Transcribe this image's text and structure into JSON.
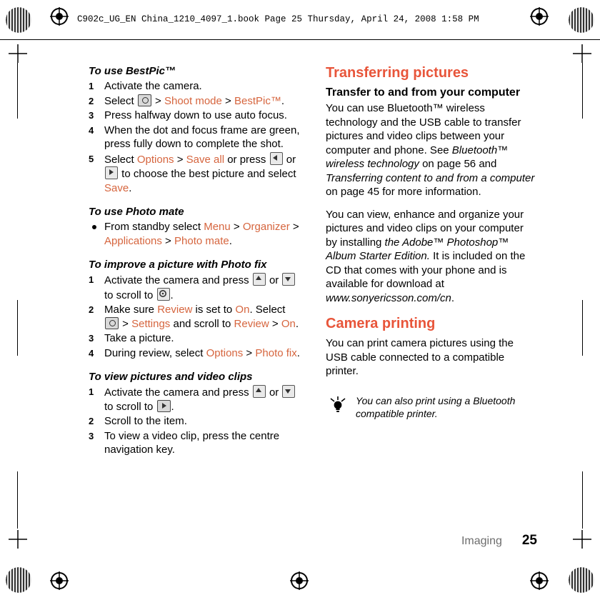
{
  "header": {
    "filename_line": "C902c_UG_EN China_1210_4097_1.book  Page 25  Thursday, April 24, 2008  1:58 PM"
  },
  "colors": {
    "accent": "#E8553A",
    "link": "#D6653E",
    "footer_gray": "#6d6d6d"
  },
  "left_column": {
    "bestpic": {
      "heading": "To use BestPic™",
      "steps": [
        {
          "num": "1",
          "parts": [
            {
              "t": "text",
              "v": "Activate the camera."
            }
          ]
        },
        {
          "num": "2",
          "parts": [
            {
              "t": "text",
              "v": "Select "
            },
            {
              "t": "icon",
              "v": "camera-icon"
            },
            {
              "t": "text",
              "v": " > "
            },
            {
              "t": "link",
              "v": "Shoot mode"
            },
            {
              "t": "text",
              "v": " > "
            },
            {
              "t": "link",
              "v": "BestPic™"
            },
            {
              "t": "text",
              "v": "."
            }
          ]
        },
        {
          "num": "3",
          "parts": [
            {
              "t": "text",
              "v": "Press halfway down to use auto focus."
            }
          ]
        },
        {
          "num": "4",
          "parts": [
            {
              "t": "text",
              "v": "When the dot and focus frame are green, press fully down to complete the shot."
            }
          ]
        },
        {
          "num": "5",
          "parts": [
            {
              "t": "text",
              "v": "Select "
            },
            {
              "t": "link",
              "v": "Options"
            },
            {
              "t": "text",
              "v": " > "
            },
            {
              "t": "link",
              "v": "Save all"
            },
            {
              "t": "text",
              "v": " or press "
            },
            {
              "t": "icon",
              "v": "nav-left-icon"
            },
            {
              "t": "text",
              "v": " or "
            },
            {
              "t": "icon",
              "v": "nav-right-icon"
            },
            {
              "t": "text",
              "v": " to choose the best picture and select "
            },
            {
              "t": "link",
              "v": "Save"
            },
            {
              "t": "text",
              "v": "."
            }
          ]
        }
      ]
    },
    "photomate": {
      "heading": "To use Photo mate",
      "bullets": [
        {
          "parts": [
            {
              "t": "text",
              "v": "From standby select "
            },
            {
              "t": "link",
              "v": "Menu"
            },
            {
              "t": "text",
              "v": " > "
            },
            {
              "t": "link",
              "v": "Organizer"
            },
            {
              "t": "text",
              "v": " > "
            },
            {
              "t": "link",
              "v": "Applications"
            },
            {
              "t": "text",
              "v": " > "
            },
            {
              "t": "link",
              "v": "Photo mate"
            },
            {
              "t": "text",
              "v": "."
            }
          ]
        }
      ]
    },
    "photofix": {
      "heading": "To improve a picture with Photo fix",
      "steps": [
        {
          "num": "1",
          "parts": [
            {
              "t": "text",
              "v": "Activate the camera and press "
            },
            {
              "t": "icon",
              "v": "nav-up-icon"
            },
            {
              "t": "text",
              "v": " or "
            },
            {
              "t": "icon",
              "v": "nav-down-icon"
            },
            {
              "t": "text",
              "v": " to scroll to "
            },
            {
              "t": "icon",
              "v": "settings-icon"
            },
            {
              "t": "text",
              "v": "."
            }
          ]
        },
        {
          "num": "2",
          "parts": [
            {
              "t": "text",
              "v": "Make sure "
            },
            {
              "t": "link",
              "v": "Review"
            },
            {
              "t": "text",
              "v": " is set to "
            },
            {
              "t": "link",
              "v": "On"
            },
            {
              "t": "text",
              "v": ". Select "
            },
            {
              "t": "icon",
              "v": "camera-icon"
            },
            {
              "t": "text",
              "v": " > "
            },
            {
              "t": "link",
              "v": "Settings"
            },
            {
              "t": "text",
              "v": " and scroll to "
            },
            {
              "t": "link",
              "v": "Review"
            },
            {
              "t": "text",
              "v": " > "
            },
            {
              "t": "link",
              "v": "On"
            },
            {
              "t": "text",
              "v": "."
            }
          ]
        },
        {
          "num": "3",
          "parts": [
            {
              "t": "text",
              "v": "Take a picture."
            }
          ]
        },
        {
          "num": "4",
          "parts": [
            {
              "t": "text",
              "v": "During review, select "
            },
            {
              "t": "link",
              "v": "Options"
            },
            {
              "t": "text",
              "v": " > "
            },
            {
              "t": "link",
              "v": "Photo fix"
            },
            {
              "t": "text",
              "v": "."
            }
          ]
        }
      ]
    },
    "viewpictures": {
      "heading": "To view pictures and video clips",
      "steps": [
        {
          "num": "1",
          "parts": [
            {
              "t": "text",
              "v": "Activate the camera and press "
            },
            {
              "t": "icon",
              "v": "nav-up-icon"
            },
            {
              "t": "text",
              "v": " or "
            },
            {
              "t": "icon",
              "v": "nav-down-icon"
            },
            {
              "t": "text",
              "v": " to scroll to "
            },
            {
              "t": "icon",
              "v": "play-icon"
            },
            {
              "t": "text",
              "v": "."
            }
          ]
        },
        {
          "num": "2",
          "parts": [
            {
              "t": "text",
              "v": "Scroll to the item."
            }
          ]
        },
        {
          "num": "3",
          "parts": [
            {
              "t": "text",
              "v": "To view a video clip, press the centre navigation key."
            }
          ]
        }
      ]
    }
  },
  "right_column": {
    "section_title": "Transferring pictures",
    "subhead": "Transfer to and from your computer",
    "paragraph1": [
      {
        "t": "text",
        "v": "You can use Bluetooth™ wireless technology and the USB cable to transfer pictures and video clips between your computer and phone. See "
      },
      {
        "t": "em",
        "v": "Bluetooth™ wireless technology"
      },
      {
        "t": "text",
        "v": " on page 56 and "
      },
      {
        "t": "em",
        "v": "Transferring content to and from a computer"
      },
      {
        "t": "text",
        "v": " on page 45 for more information."
      }
    ],
    "paragraph2": [
      {
        "t": "text",
        "v": "You can view, enhance and organize your pictures and video clips on your computer by installing "
      },
      {
        "t": "em",
        "v": "the Adobe™ Photoshop™ Album Starter Edition."
      },
      {
        "t": "text",
        "v": " It is included on the CD that comes with your phone and is available for download at "
      },
      {
        "t": "em",
        "v": "www.sonyericsson.com/cn"
      },
      {
        "t": "text",
        "v": "."
      }
    ],
    "section_title2": "Camera printing",
    "paragraph3": [
      {
        "t": "text",
        "v": "You can print camera pictures using the USB cable connected to a compatible printer."
      }
    ],
    "tip": {
      "icon": "lightbulb-icon",
      "text": "You can also print using a Bluetooth compatible printer."
    }
  },
  "footer": {
    "chapter": "Imaging",
    "page_number": "25"
  }
}
